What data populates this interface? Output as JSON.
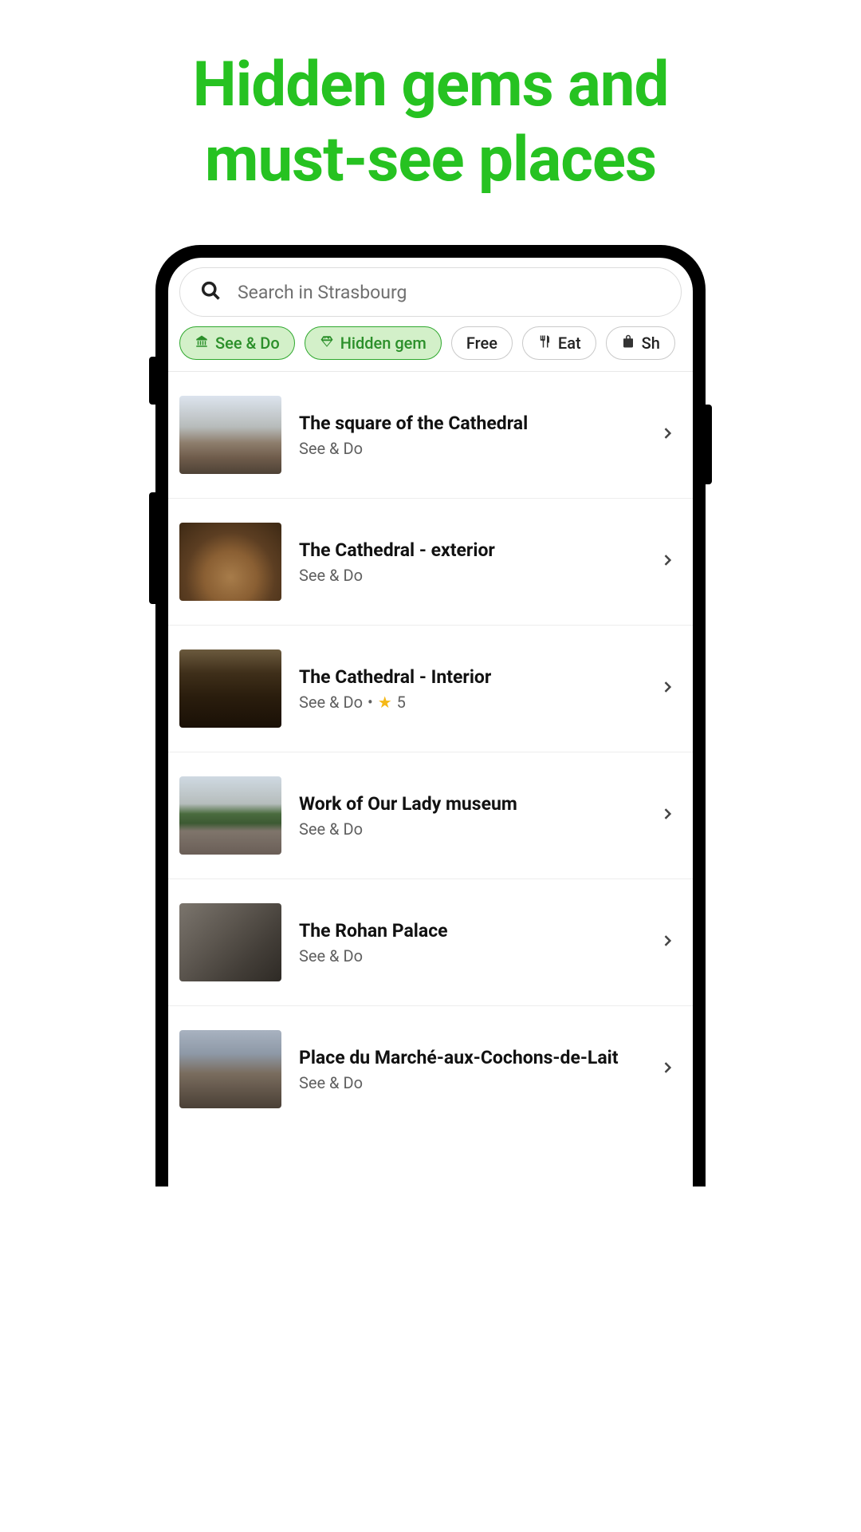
{
  "hero": {
    "line1": "Hidden gems and",
    "line2": "must-see places"
  },
  "search": {
    "placeholder": "Search in Strasbourg"
  },
  "chips": [
    {
      "label": "See & Do",
      "icon": "building",
      "active": true
    },
    {
      "label": "Hidden gem",
      "icon": "gem",
      "active": true
    },
    {
      "label": "Free",
      "icon": "",
      "active": false
    },
    {
      "label": "Eat",
      "icon": "utensils",
      "active": false
    },
    {
      "label": "Sh",
      "icon": "bag",
      "active": false
    }
  ],
  "items": [
    {
      "title": "The square of the Cathedral",
      "category": "See & Do",
      "rating": null
    },
    {
      "title": "The Cathedral - exterior",
      "category": "See & Do",
      "rating": null
    },
    {
      "title": "The Cathedral - Interior",
      "category": "See & Do",
      "rating": "5"
    },
    {
      "title": "Work of Our Lady museum",
      "category": "See & Do",
      "rating": null
    },
    {
      "title": "The Rohan Palace",
      "category": "See & Do",
      "rating": null
    },
    {
      "title": "Place du Marché-aux-Cochons-de-Lait",
      "category": "See & Do",
      "rating": null
    }
  ]
}
